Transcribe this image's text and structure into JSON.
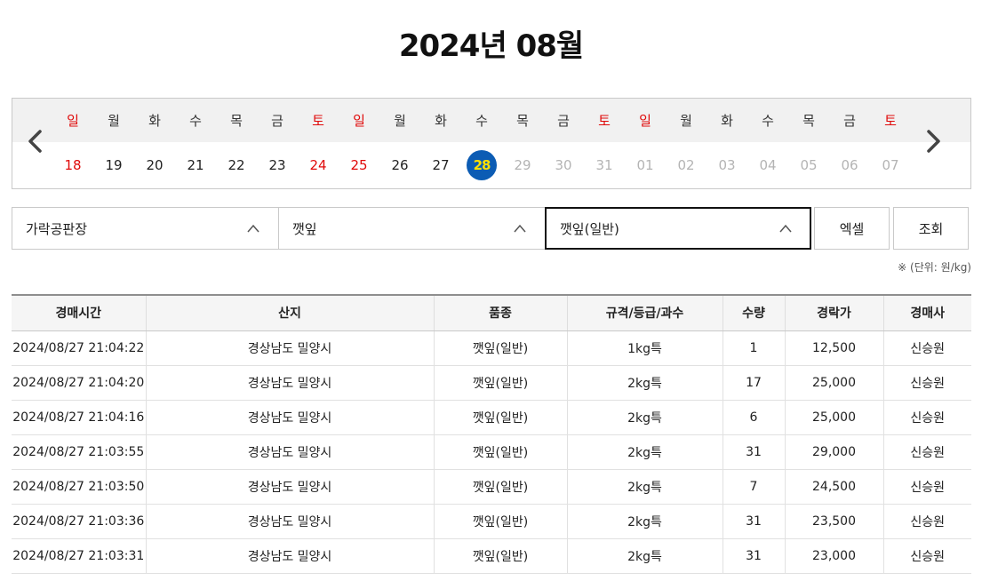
{
  "page": {
    "title": "2024년 08월"
  },
  "calendar": {
    "prev_icon": "chevron-left-icon",
    "next_icon": "chevron-right-icon",
    "days": [
      {
        "dow": "일",
        "day": "18",
        "red": true,
        "disabled": false,
        "selected": false
      },
      {
        "dow": "월",
        "day": "19",
        "red": false,
        "disabled": false,
        "selected": false
      },
      {
        "dow": "화",
        "day": "20",
        "red": false,
        "disabled": false,
        "selected": false
      },
      {
        "dow": "수",
        "day": "21",
        "red": false,
        "disabled": false,
        "selected": false
      },
      {
        "dow": "목",
        "day": "22",
        "red": false,
        "disabled": false,
        "selected": false
      },
      {
        "dow": "금",
        "day": "23",
        "red": false,
        "disabled": false,
        "selected": false
      },
      {
        "dow": "토",
        "day": "24",
        "red": true,
        "disabled": false,
        "selected": false
      },
      {
        "dow": "일",
        "day": "25",
        "red": true,
        "disabled": false,
        "selected": false
      },
      {
        "dow": "월",
        "day": "26",
        "red": false,
        "disabled": false,
        "selected": false
      },
      {
        "dow": "화",
        "day": "27",
        "red": false,
        "disabled": false,
        "selected": false
      },
      {
        "dow": "수",
        "day": "28",
        "red": false,
        "disabled": false,
        "selected": true
      },
      {
        "dow": "목",
        "day": "29",
        "red": false,
        "disabled": true,
        "selected": false
      },
      {
        "dow": "금",
        "day": "30",
        "red": false,
        "disabled": true,
        "selected": false
      },
      {
        "dow": "토",
        "day": "31",
        "red": true,
        "disabled": true,
        "selected": false
      },
      {
        "dow": "일",
        "day": "01",
        "red": true,
        "disabled": true,
        "selected": false
      },
      {
        "dow": "월",
        "day": "02",
        "red": false,
        "disabled": true,
        "selected": false
      },
      {
        "dow": "화",
        "day": "03",
        "red": false,
        "disabled": true,
        "selected": false
      },
      {
        "dow": "수",
        "day": "04",
        "red": false,
        "disabled": true,
        "selected": false
      },
      {
        "dow": "목",
        "day": "05",
        "red": false,
        "disabled": true,
        "selected": false
      },
      {
        "dow": "금",
        "day": "06",
        "red": false,
        "disabled": true,
        "selected": false
      },
      {
        "dow": "토",
        "day": "07",
        "red": true,
        "disabled": true,
        "selected": false
      }
    ]
  },
  "filters": {
    "market": "가락공판장",
    "item": "깻잎",
    "variety": "깻잎(일반)",
    "dropdown_icon": "chevron-up-icon",
    "excel_label": "엑셀",
    "search_label": "조회"
  },
  "unit_note": "※ (단위: 원/kg)",
  "table": {
    "headers": [
      "경매시간",
      "산지",
      "품종",
      "규격/등급/과수",
      "수량",
      "경락가",
      "경매사"
    ],
    "rows": [
      [
        "2024/08/27 21:04:22",
        "경상남도 밀양시",
        "깻잎(일반)",
        "1kg특",
        "1",
        "12,500",
        "신승원"
      ],
      [
        "2024/08/27 21:04:20",
        "경상남도 밀양시",
        "깻잎(일반)",
        "2kg특",
        "17",
        "25,000",
        "신승원"
      ],
      [
        "2024/08/27 21:04:16",
        "경상남도 밀양시",
        "깻잎(일반)",
        "2kg특",
        "6",
        "25,000",
        "신승원"
      ],
      [
        "2024/08/27 21:03:55",
        "경상남도 밀양시",
        "깻잎(일반)",
        "2kg특",
        "31",
        "29,000",
        "신승원"
      ],
      [
        "2024/08/27 21:03:50",
        "경상남도 밀양시",
        "깻잎(일반)",
        "2kg특",
        "7",
        "24,500",
        "신승원"
      ],
      [
        "2024/08/27 21:03:36",
        "경상남도 밀양시",
        "깻잎(일반)",
        "2kg특",
        "31",
        "23,500",
        "신승원"
      ],
      [
        "2024/08/27 21:03:31",
        "경상남도 밀양시",
        "깻잎(일반)",
        "2kg특",
        "31",
        "23,000",
        "신승원"
      ]
    ]
  },
  "colors": {
    "selected_day_bg": "#0c5cb4",
    "selected_day_text": "#ffe000",
    "weekend_red": "#e00a0a",
    "disabled_gray": "#b4b4b4"
  }
}
